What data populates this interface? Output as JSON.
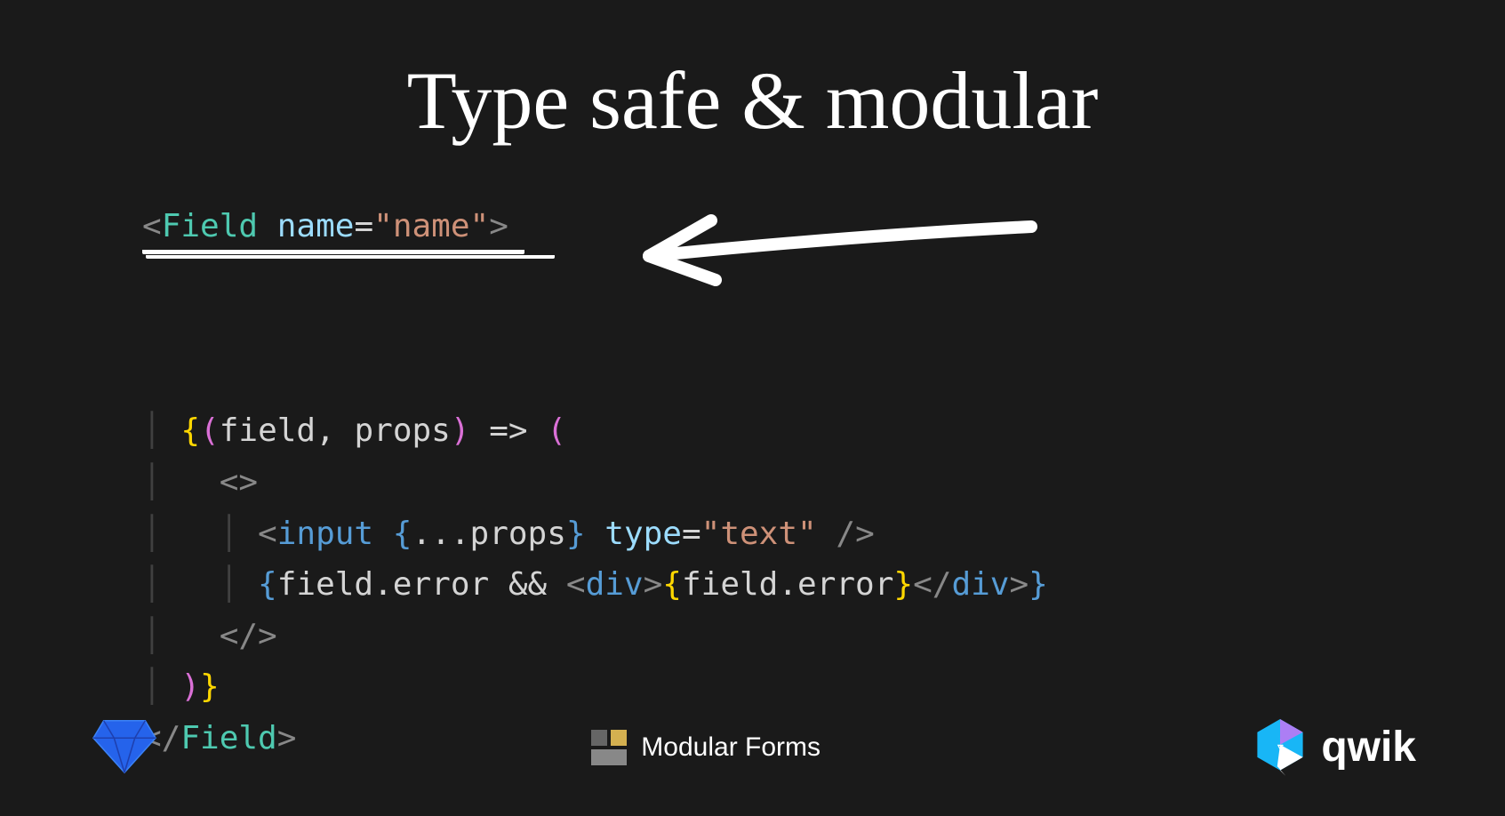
{
  "title": "Type safe & modular",
  "code": {
    "line1": {
      "lt": "<",
      "component": "Field",
      "space": " ",
      "attr": "name",
      "eq": "=",
      "string": "\"name\"",
      "gt": ">"
    },
    "line2": {
      "brace_open": "{",
      "paren_open": "(",
      "param1": "field",
      "comma": ", ",
      "param2": "props",
      "paren_close": ")",
      "arrow": " => ",
      "paren_open2": "("
    },
    "line3": {
      "frag_open": "<>"
    },
    "line4": {
      "lt": "<",
      "tag": "input",
      "space": " ",
      "brace_open": "{",
      "spread": "...",
      "props": "props",
      "brace_close": "}",
      "space2": " ",
      "attr": "type",
      "eq": "=",
      "string": "\"text\"",
      "space3": " ",
      "slash_gt": "/>"
    },
    "line5": {
      "brace_open": "{",
      "field": "field",
      "dot": ".",
      "error": "error",
      "and": " && ",
      "lt": "<",
      "div": "div",
      "gt": ">",
      "brace_open2": "{",
      "field2": "field",
      "dot2": ".",
      "error2": "error",
      "brace_close2": "}",
      "lt_slash": "</",
      "div2": "div",
      "gt2": ">",
      "brace_close": "}"
    },
    "line6": {
      "frag_close": "</>"
    },
    "line7": {
      "paren_close": ")",
      "brace_close": "}"
    },
    "line8": {
      "lt_slash": "</",
      "component": "Field",
      "gt": ">"
    }
  },
  "footer": {
    "modular_forms": "Modular Forms",
    "qwik": "qwik"
  },
  "colors": {
    "background": "#1a1a1a",
    "text": "#e0e0e0",
    "component": "#4ec9b0",
    "attr": "#9cdcfe",
    "string": "#ce9178",
    "brace_yellow": "#ffd700",
    "brace_pink": "#da70d6",
    "brace_blue": "#569cd6",
    "tag": "#569cd6",
    "punct": "#888"
  }
}
